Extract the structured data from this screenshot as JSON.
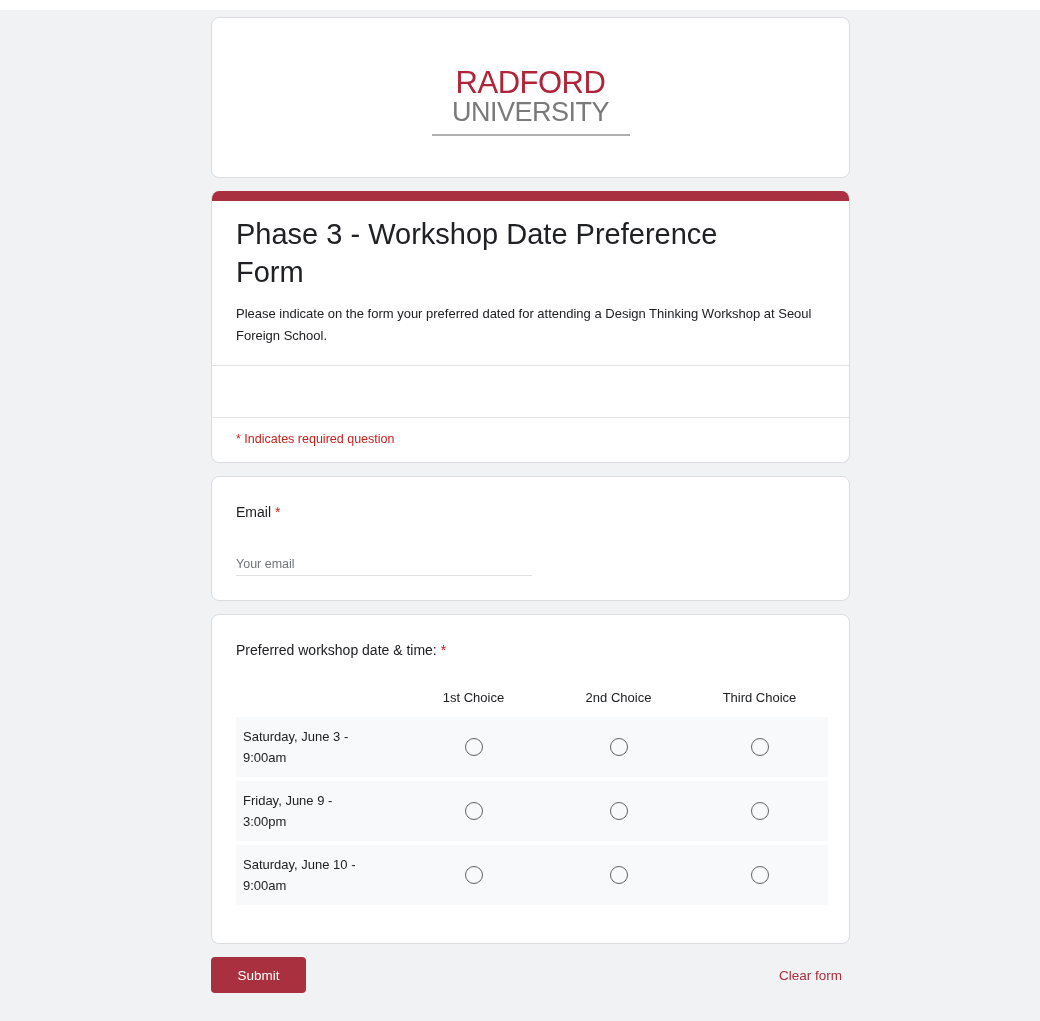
{
  "logo": {
    "line_1": "RADFORD",
    "line_2": "UNIVERSITY"
  },
  "form": {
    "title": "Phase 3 - Workshop Date Preference Form",
    "description": "Please indicate on the form your preferred dated for attending a Design Thinking Workshop at Seoul Foreign School.",
    "required_note": "* Indicates required question"
  },
  "email_question": {
    "label": "Email",
    "required_mark": "*",
    "placeholder": "Your email"
  },
  "grid_question": {
    "label": "Preferred workshop date & time:",
    "required_mark": "*",
    "columns": [
      "1st Choice",
      "2nd Choice",
      "Third Choice"
    ],
    "rows": [
      {
        "label": "Saturday, June 3 - 9:00am",
        "choices": [
          {
            "selected": false
          },
          {
            "selected": false
          },
          {
            "selected": false
          }
        ]
      },
      {
        "label": "Friday, June 9 - 3:00pm",
        "choices": [
          {
            "selected": false
          },
          {
            "selected": false
          },
          {
            "selected": false
          }
        ]
      },
      {
        "label": "Saturday, June 10 - 9:00am",
        "choices": [
          {
            "selected": false
          },
          {
            "selected": false
          },
          {
            "selected": false
          }
        ]
      }
    ]
  },
  "actions": {
    "submit": "Submit",
    "clear": "Clear form"
  }
}
